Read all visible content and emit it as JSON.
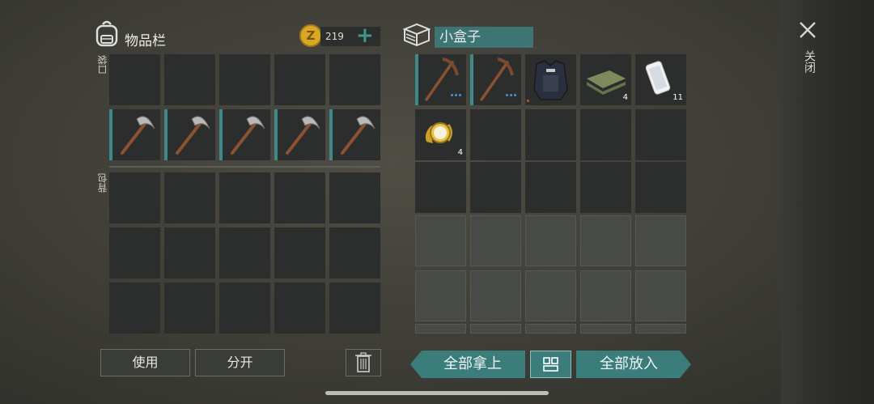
{
  "inventory": {
    "title": "物品栏",
    "coin_count": "219",
    "coin_symbol": "Z",
    "add_label": "+",
    "pocket_label": "口袋",
    "backpack_label": "背包",
    "pocket_items": [
      "",
      "",
      "",
      "",
      "",
      "pickaxe",
      "pickaxe",
      "pickaxe",
      "pickaxe",
      "pickaxe"
    ],
    "backpack_slots": 15
  },
  "container": {
    "title": "小盒子",
    "items": [
      {
        "icon": "wooden-pickaxe-icon",
        "count": "",
        "dots": true
      },
      {
        "icon": "wooden-pickaxe-icon",
        "count": "",
        "dots": true
      },
      {
        "icon": "police-vest-icon",
        "count": "",
        "dots": false
      },
      {
        "icon": "cloth-icon",
        "count": "4",
        "dots": false
      },
      {
        "icon": "phone-icon",
        "count": "11",
        "dots": false
      },
      {
        "icon": "gold-watch-icon",
        "count": "4",
        "dots": false
      }
    ]
  },
  "actions": {
    "use": "使用",
    "split": "分开",
    "take_all": "全部拿上",
    "put_all": "全部放入",
    "close": "关闭"
  },
  "colors": {
    "accent": "#3a7d7b",
    "slot": "#2b2e2d",
    "coin": "#d9a826"
  }
}
